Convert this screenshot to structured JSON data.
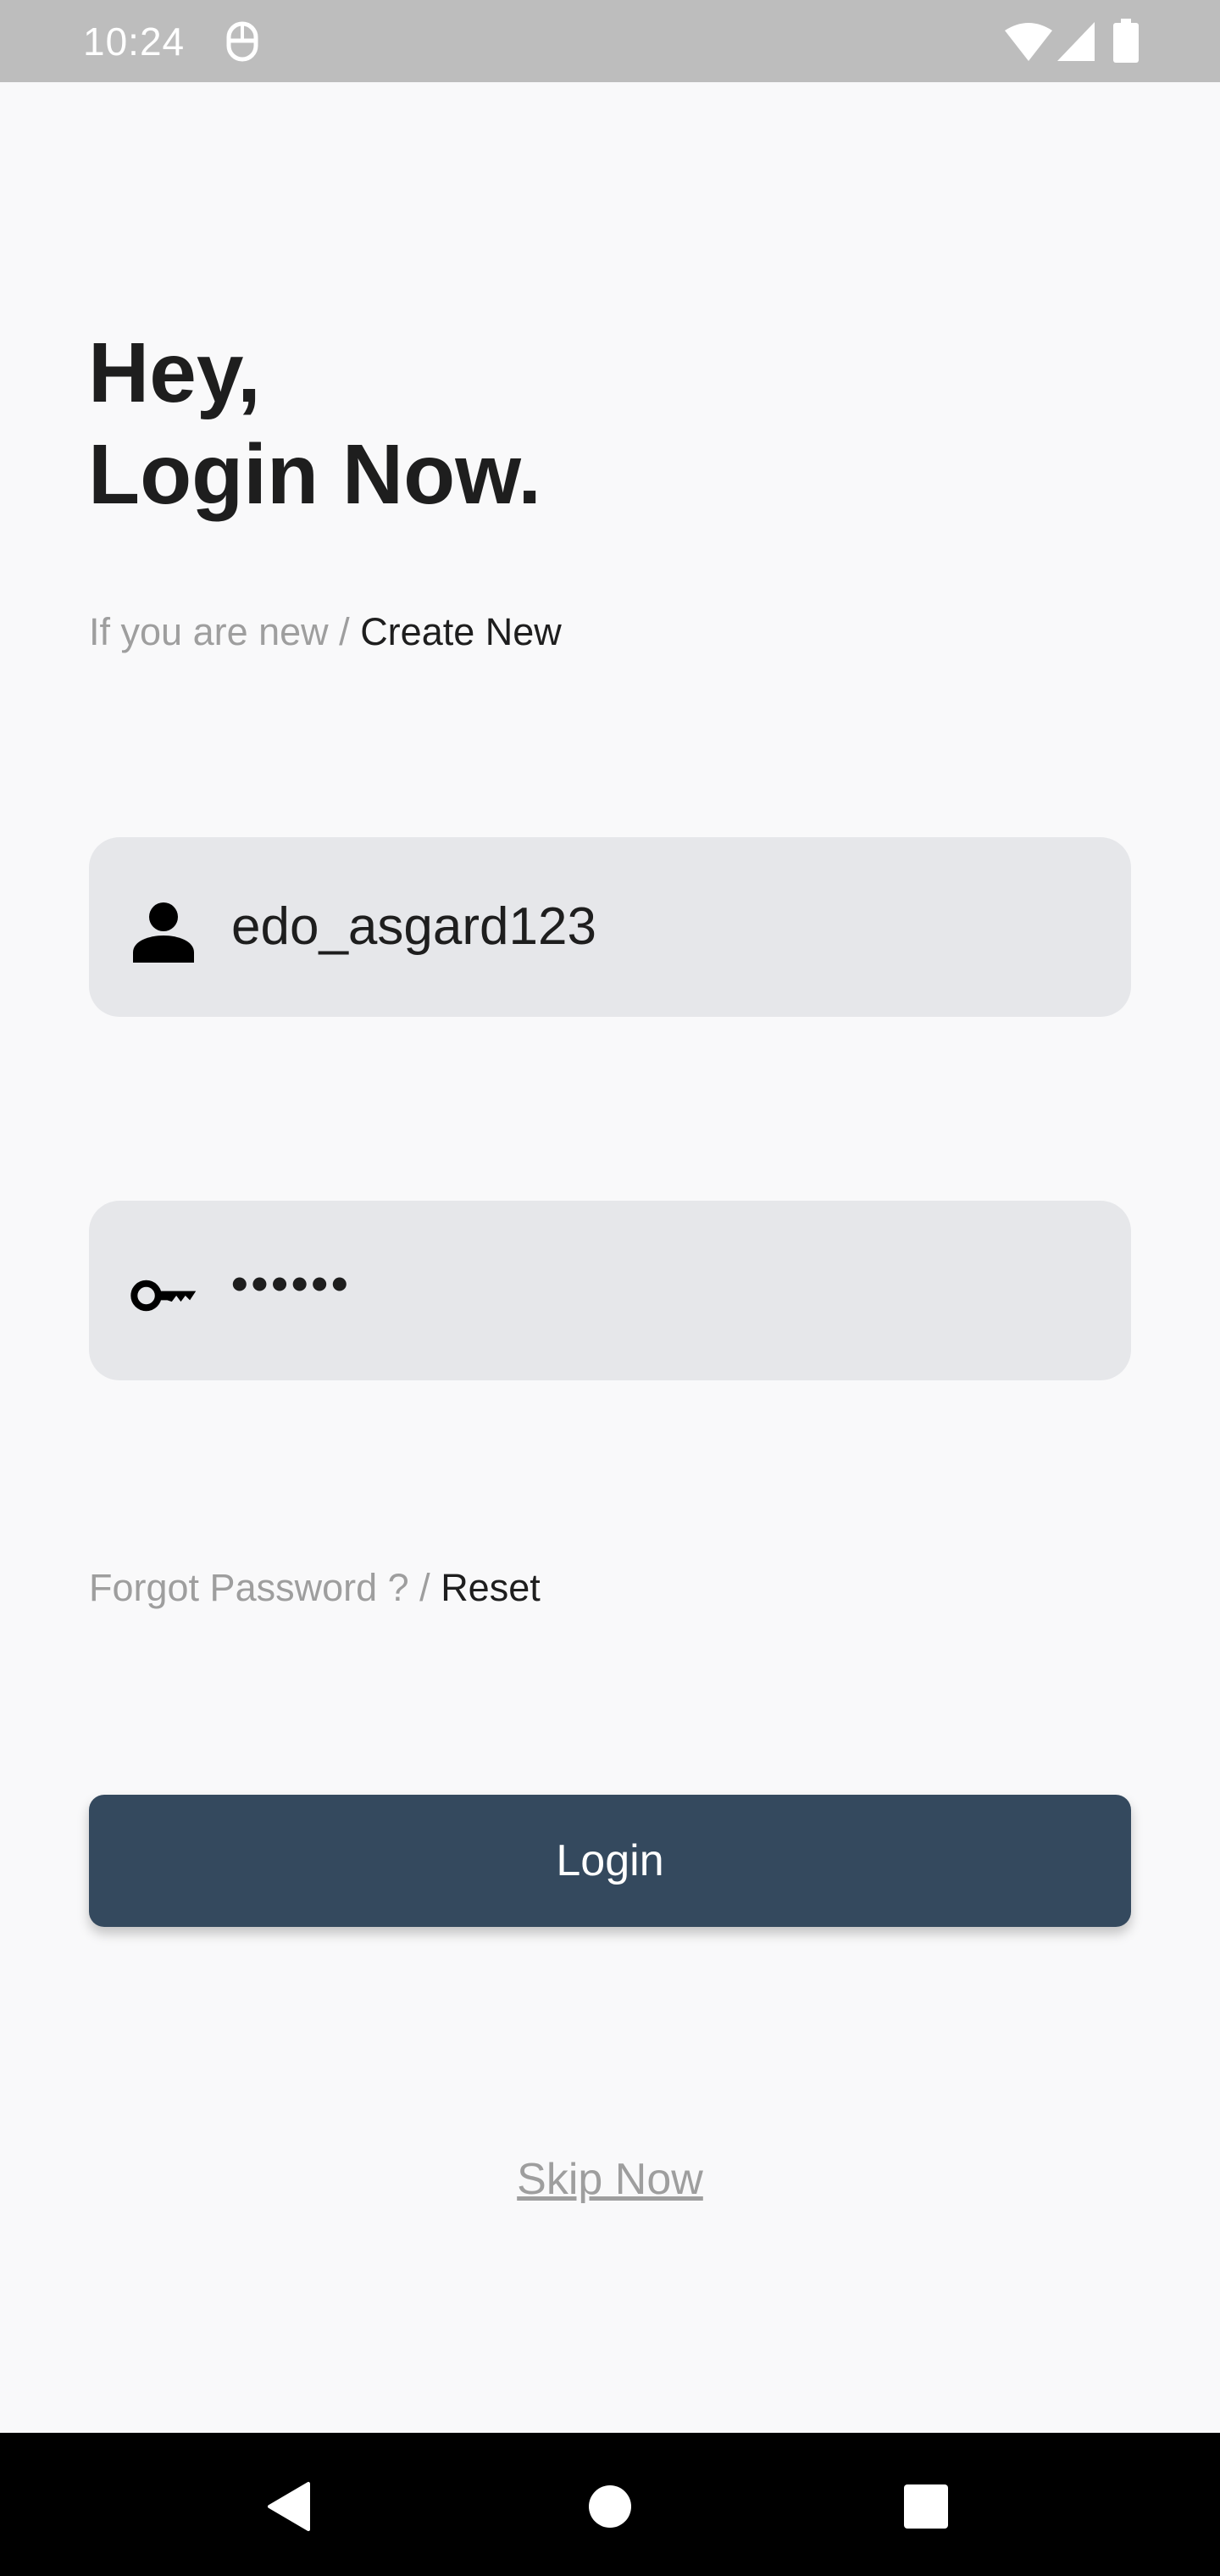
{
  "status_bar": {
    "time": "10:24",
    "icons": [
      "notification-icon",
      "wifi-icon",
      "cell-signal-icon",
      "battery-icon"
    ]
  },
  "header": {
    "line1": "Hey,",
    "line2": "Login Now."
  },
  "signup": {
    "prompt": "If you are new /",
    "link": "Create New"
  },
  "username_field": {
    "icon": "person-icon",
    "value": "edo_asgard123"
  },
  "password_field": {
    "icon": "key-icon",
    "value": "••••••"
  },
  "forgot": {
    "prompt": "Forgot Password ? /",
    "link": "Reset"
  },
  "login_button": {
    "label": "Login",
    "color": "#34495e"
  },
  "skip": {
    "label": "Skip Now"
  },
  "nav_bar": {
    "icons": [
      "back-icon",
      "home-icon",
      "recents-icon"
    ]
  },
  "colors": {
    "background": "#f9f9fa",
    "field_background": "#e6e7ea",
    "muted_text": "#9e9e9e",
    "dark_text": "#1e1e1e",
    "status_bar": "#bdbdbd"
  }
}
